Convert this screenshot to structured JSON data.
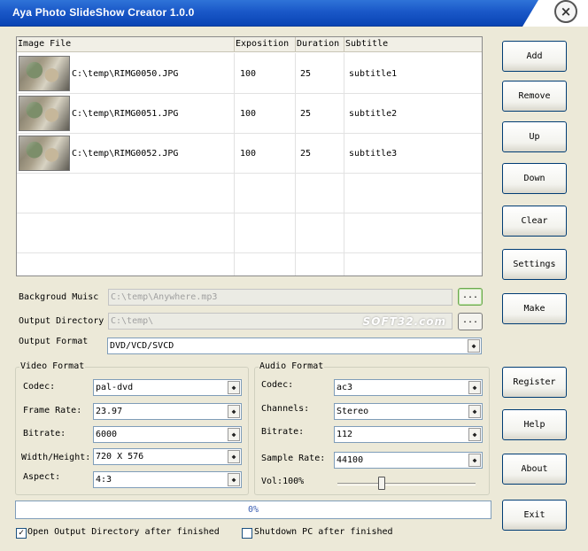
{
  "window": {
    "title": "Aya Photo SlideShow Creator 1.0.0",
    "close_glyph": "×"
  },
  "grid": {
    "columns": [
      "Image File",
      "Exposition",
      "Duration",
      "Subtitle"
    ],
    "rows": [
      {
        "file": "C:\\temp\\RIMG0050.JPG",
        "exposition": "100",
        "duration": "25",
        "subtitle": "subtitle1"
      },
      {
        "file": "C:\\temp\\RIMG0051.JPG",
        "exposition": "100",
        "duration": "25",
        "subtitle": "subtitle2"
      },
      {
        "file": "C:\\temp\\RIMG0052.JPG",
        "exposition": "100",
        "duration": "25",
        "subtitle": "subtitle3"
      }
    ]
  },
  "music": {
    "label": "Backgroud Muisc",
    "value": "C:\\temp\\Anywhere.mp3",
    "browse": "..."
  },
  "output_dir": {
    "label": "Output Directory",
    "value": "C:\\temp\\",
    "browse": "...",
    "watermark": "SOFT32.com"
  },
  "output_format": {
    "label": "Output Format",
    "value": "DVD/VCD/SVCD"
  },
  "video": {
    "legend": "Video Format",
    "codec_label": "Codec:",
    "codec": "pal-dvd",
    "framerate_label": "Frame Rate:",
    "framerate": "23.97",
    "bitrate_label": "Bitrate:",
    "bitrate": "6000",
    "size_label": "Width/Height:",
    "size": "720 X 576",
    "aspect_label": "Aspect:",
    "aspect": "4:3"
  },
  "audio": {
    "legend": "Audio Format",
    "codec_label": "Codec:",
    "codec": "ac3",
    "channels_label": "Channels:",
    "channels": "Stereo",
    "bitrate_label": "Bitrate:",
    "bitrate": "112",
    "samplerate_label": "Sample Rate:",
    "samplerate": "44100",
    "volume_label": "Vol:100%",
    "volume_level": 0.32
  },
  "buttons": {
    "add": "Add",
    "remove": "Remove",
    "up": "Up",
    "down": "Down",
    "clear": "Clear",
    "settings": "Settings",
    "make": "Make",
    "register": "Register",
    "help": "Help",
    "about": "About",
    "exit": "Exit"
  },
  "progress": {
    "text": "0%",
    "value": 0
  },
  "options": {
    "open_dir_label": "Open Output Directory after finished",
    "open_dir_checked": true,
    "shutdown_label": "Shutdown PC after finished",
    "shutdown_checked": false
  },
  "icons": {
    "combo_arrow": "combo-arrow-icon",
    "check_mark": "check-icon",
    "thumbnail": "photo-thumbnail-icon"
  }
}
